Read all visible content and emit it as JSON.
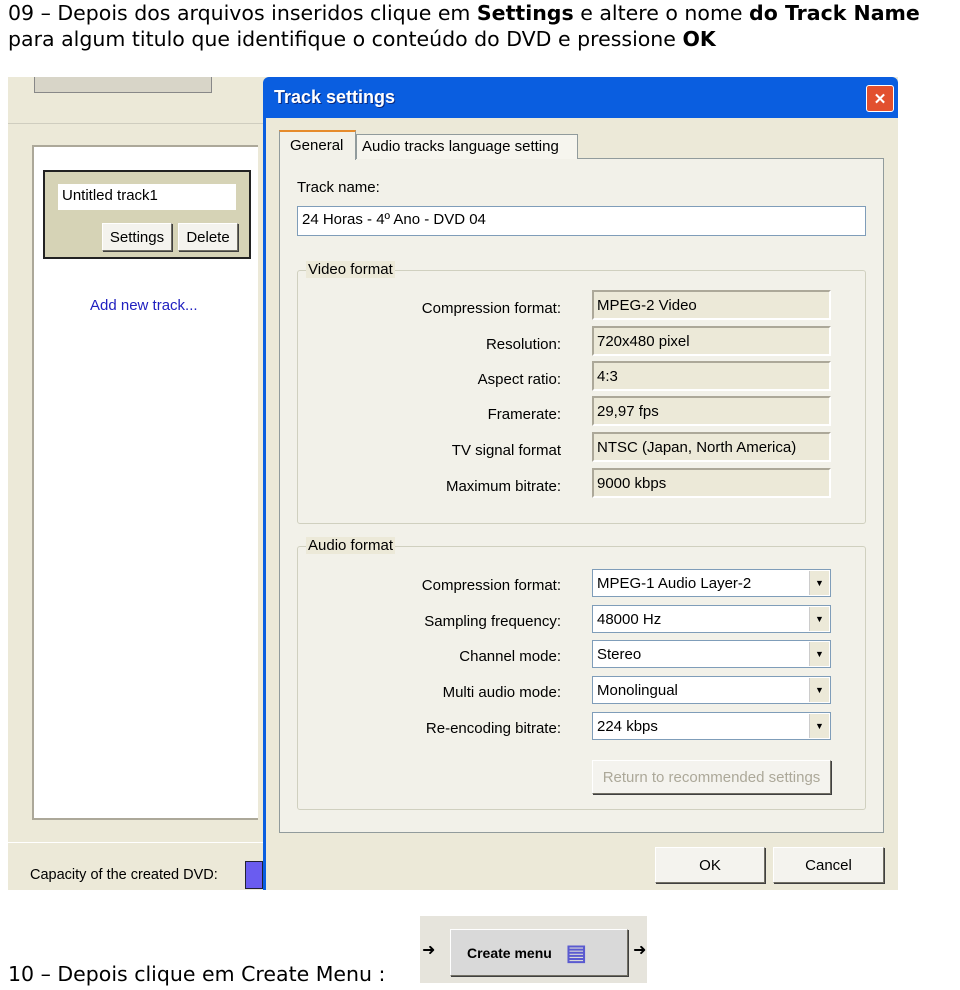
{
  "step9": {
    "p1": "09 – Depois dos arquivos inseridos clique em ",
    "b1": "Settings",
    "p2": " e altere o nome ",
    "b2": "do Track Name",
    "p3": " para algum titulo que identifique o conteúdo do DVD e pressione ",
    "b3": "OK"
  },
  "left": {
    "track_name": "Untitled track1",
    "settings_label": "Settings",
    "delete_label": "Delete",
    "add_track": "Add new track...",
    "capacity_label": "Capacity of the created DVD:"
  },
  "dialog": {
    "title": "Track settings",
    "close": "✕",
    "tabs": [
      {
        "label": "General",
        "active": true
      },
      {
        "label": "Audio tracks language setting",
        "active": false
      }
    ],
    "track_name_label": "Track name:",
    "track_name_value": "24 Horas - 4º Ano - DVD 04",
    "video": {
      "title": "Video format",
      "rows": [
        {
          "label": "Compression format:",
          "value": "MPEG-2 Video"
        },
        {
          "label": "Resolution:",
          "value": "720x480 pixel"
        },
        {
          "label": "Aspect ratio:",
          "value": "4:3"
        },
        {
          "label": "Framerate:",
          "value": "29,97 fps"
        },
        {
          "label": "TV signal format",
          "value": "NTSC (Japan, North America)"
        },
        {
          "label": "Maximum bitrate:",
          "value": "9000 kbps"
        }
      ]
    },
    "audio": {
      "title": "Audio format",
      "rows": [
        {
          "label": "Compression format:",
          "value": "MPEG-1 Audio Layer-2"
        },
        {
          "label": "Sampling frequency:",
          "value": "48000 Hz"
        },
        {
          "label": "Channel mode:",
          "value": "Stereo"
        },
        {
          "label": "Multi audio mode:",
          "value": "Monolingual"
        },
        {
          "label": "Re-encoding bitrate:",
          "value": "224 kbps"
        }
      ]
    },
    "return_label": "Return to recommended settings",
    "ok_label": "OK",
    "cancel_label": "Cancel"
  },
  "step10": {
    "text": "10 – Depois clique em Create Menu :",
    "button": "Create menu"
  }
}
